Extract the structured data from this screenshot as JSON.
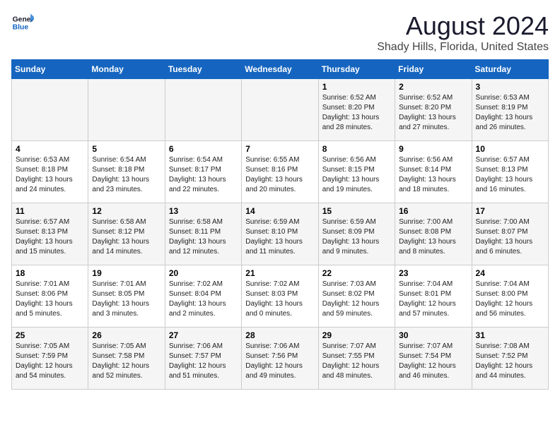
{
  "logo": {
    "line1": "General",
    "line2": "Blue"
  },
  "title": "August 2024",
  "subtitle": "Shady Hills, Florida, United States",
  "days_of_week": [
    "Sunday",
    "Monday",
    "Tuesday",
    "Wednesday",
    "Thursday",
    "Friday",
    "Saturday"
  ],
  "weeks": [
    [
      {
        "day": "",
        "info": ""
      },
      {
        "day": "",
        "info": ""
      },
      {
        "day": "",
        "info": ""
      },
      {
        "day": "",
        "info": ""
      },
      {
        "day": "1",
        "info": "Sunrise: 6:52 AM\nSunset: 8:20 PM\nDaylight: 13 hours\nand 28 minutes."
      },
      {
        "day": "2",
        "info": "Sunrise: 6:52 AM\nSunset: 8:20 PM\nDaylight: 13 hours\nand 27 minutes."
      },
      {
        "day": "3",
        "info": "Sunrise: 6:53 AM\nSunset: 8:19 PM\nDaylight: 13 hours\nand 26 minutes."
      }
    ],
    [
      {
        "day": "4",
        "info": "Sunrise: 6:53 AM\nSunset: 8:18 PM\nDaylight: 13 hours\nand 24 minutes."
      },
      {
        "day": "5",
        "info": "Sunrise: 6:54 AM\nSunset: 8:18 PM\nDaylight: 13 hours\nand 23 minutes."
      },
      {
        "day": "6",
        "info": "Sunrise: 6:54 AM\nSunset: 8:17 PM\nDaylight: 13 hours\nand 22 minutes."
      },
      {
        "day": "7",
        "info": "Sunrise: 6:55 AM\nSunset: 8:16 PM\nDaylight: 13 hours\nand 20 minutes."
      },
      {
        "day": "8",
        "info": "Sunrise: 6:56 AM\nSunset: 8:15 PM\nDaylight: 13 hours\nand 19 minutes."
      },
      {
        "day": "9",
        "info": "Sunrise: 6:56 AM\nSunset: 8:14 PM\nDaylight: 13 hours\nand 18 minutes."
      },
      {
        "day": "10",
        "info": "Sunrise: 6:57 AM\nSunset: 8:13 PM\nDaylight: 13 hours\nand 16 minutes."
      }
    ],
    [
      {
        "day": "11",
        "info": "Sunrise: 6:57 AM\nSunset: 8:13 PM\nDaylight: 13 hours\nand 15 minutes."
      },
      {
        "day": "12",
        "info": "Sunrise: 6:58 AM\nSunset: 8:12 PM\nDaylight: 13 hours\nand 14 minutes."
      },
      {
        "day": "13",
        "info": "Sunrise: 6:58 AM\nSunset: 8:11 PM\nDaylight: 13 hours\nand 12 minutes."
      },
      {
        "day": "14",
        "info": "Sunrise: 6:59 AM\nSunset: 8:10 PM\nDaylight: 13 hours\nand 11 minutes."
      },
      {
        "day": "15",
        "info": "Sunrise: 6:59 AM\nSunset: 8:09 PM\nDaylight: 13 hours\nand 9 minutes."
      },
      {
        "day": "16",
        "info": "Sunrise: 7:00 AM\nSunset: 8:08 PM\nDaylight: 13 hours\nand 8 minutes."
      },
      {
        "day": "17",
        "info": "Sunrise: 7:00 AM\nSunset: 8:07 PM\nDaylight: 13 hours\nand 6 minutes."
      }
    ],
    [
      {
        "day": "18",
        "info": "Sunrise: 7:01 AM\nSunset: 8:06 PM\nDaylight: 13 hours\nand 5 minutes."
      },
      {
        "day": "19",
        "info": "Sunrise: 7:01 AM\nSunset: 8:05 PM\nDaylight: 13 hours\nand 3 minutes."
      },
      {
        "day": "20",
        "info": "Sunrise: 7:02 AM\nSunset: 8:04 PM\nDaylight: 13 hours\nand 2 minutes."
      },
      {
        "day": "21",
        "info": "Sunrise: 7:02 AM\nSunset: 8:03 PM\nDaylight: 13 hours\nand 0 minutes."
      },
      {
        "day": "22",
        "info": "Sunrise: 7:03 AM\nSunset: 8:02 PM\nDaylight: 12 hours\nand 59 minutes."
      },
      {
        "day": "23",
        "info": "Sunrise: 7:04 AM\nSunset: 8:01 PM\nDaylight: 12 hours\nand 57 minutes."
      },
      {
        "day": "24",
        "info": "Sunrise: 7:04 AM\nSunset: 8:00 PM\nDaylight: 12 hours\nand 56 minutes."
      }
    ],
    [
      {
        "day": "25",
        "info": "Sunrise: 7:05 AM\nSunset: 7:59 PM\nDaylight: 12 hours\nand 54 minutes."
      },
      {
        "day": "26",
        "info": "Sunrise: 7:05 AM\nSunset: 7:58 PM\nDaylight: 12 hours\nand 52 minutes."
      },
      {
        "day": "27",
        "info": "Sunrise: 7:06 AM\nSunset: 7:57 PM\nDaylight: 12 hours\nand 51 minutes."
      },
      {
        "day": "28",
        "info": "Sunrise: 7:06 AM\nSunset: 7:56 PM\nDaylight: 12 hours\nand 49 minutes."
      },
      {
        "day": "29",
        "info": "Sunrise: 7:07 AM\nSunset: 7:55 PM\nDaylight: 12 hours\nand 48 minutes."
      },
      {
        "day": "30",
        "info": "Sunrise: 7:07 AM\nSunset: 7:54 PM\nDaylight: 12 hours\nand 46 minutes."
      },
      {
        "day": "31",
        "info": "Sunrise: 7:08 AM\nSunset: 7:52 PM\nDaylight: 12 hours\nand 44 minutes."
      }
    ]
  ]
}
